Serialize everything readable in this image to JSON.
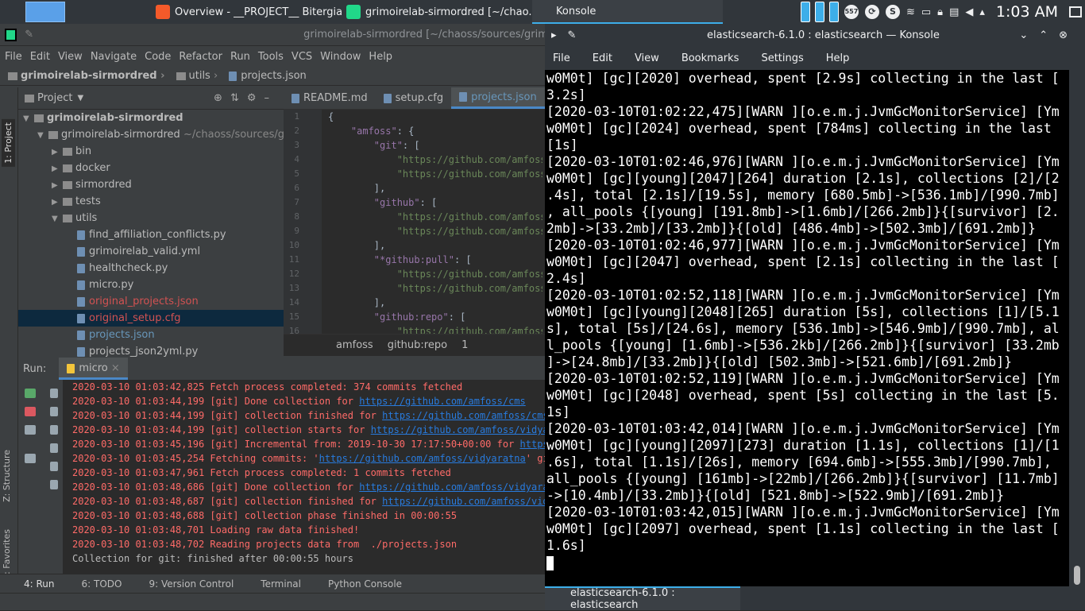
{
  "taskbar": {
    "tasks": [
      {
        "label": "Overview - __PROJECT__ Bitergia ...",
        "color": "#f45a2a"
      },
      {
        "label": "grimoirelab-sirmordred [~/chao...",
        "color": "#21d789"
      },
      {
        "label": "Konsole",
        "color": "#3b4045"
      }
    ],
    "clock": "1:03 AM",
    "tray_badge": "557"
  },
  "ide": {
    "title": "grimoirelab-sirmordred [~/chaoss/sources/grimoir",
    "menu": [
      "File",
      "Edit",
      "View",
      "Navigate",
      "Code",
      "Refactor",
      "Run",
      "Tools",
      "VCS",
      "Window",
      "Help"
    ],
    "breadcrumb": [
      "grimoirelab-sirmordred",
      "utils",
      "projects.json"
    ],
    "sidebar_tabs": [
      "1: Project",
      "Z: Structure",
      "2: Favorites"
    ],
    "project_panel": {
      "title": "Project",
      "tree": [
        {
          "label": "grimoirelab-sirmordred",
          "indent": 0,
          "arrow": "▼",
          "kind": "folder",
          "bold": true,
          "style": ""
        },
        {
          "label": "grimoirelab-sirmordred",
          "extra": "~/chaoss/sources/grim",
          "indent": 1,
          "arrow": "▼",
          "kind": "folder",
          "style": ""
        },
        {
          "label": "bin",
          "indent": 2,
          "arrow": "▶",
          "kind": "folder",
          "style": ""
        },
        {
          "label": "docker",
          "indent": 2,
          "arrow": "▶",
          "kind": "folder",
          "style": ""
        },
        {
          "label": "sirmordred",
          "indent": 2,
          "arrow": "▶",
          "kind": "folder",
          "style": ""
        },
        {
          "label": "tests",
          "indent": 2,
          "arrow": "▶",
          "kind": "folder",
          "style": ""
        },
        {
          "label": "utils",
          "indent": 2,
          "arrow": "▼",
          "kind": "folder",
          "style": ""
        },
        {
          "label": "find_affiliation_conflicts.py",
          "indent": 3,
          "arrow": "",
          "kind": "file",
          "style": ""
        },
        {
          "label": "grimoirelab_valid.yml",
          "indent": 3,
          "arrow": "",
          "kind": "file",
          "style": ""
        },
        {
          "label": "healthcheck.py",
          "indent": 3,
          "arrow": "",
          "kind": "file",
          "style": ""
        },
        {
          "label": "micro.py",
          "indent": 3,
          "arrow": "",
          "kind": "file",
          "style": ""
        },
        {
          "label": "original_projects.json",
          "indent": 3,
          "arrow": "",
          "kind": "file",
          "style": "red"
        },
        {
          "label": "original_setup.cfg",
          "indent": 3,
          "arrow": "",
          "kind": "file",
          "style": "red sel"
        },
        {
          "label": "projects.json",
          "indent": 3,
          "arrow": "",
          "kind": "file",
          "style": "blue"
        },
        {
          "label": "projects_json2yml.py",
          "indent": 3,
          "arrow": "",
          "kind": "file",
          "style": ""
        }
      ]
    },
    "editor": {
      "tabs": [
        {
          "label": "README.md",
          "active": false
        },
        {
          "label": "setup.cfg",
          "active": false
        },
        {
          "label": "projects.json",
          "active": true
        }
      ],
      "line_numbers": [
        "1",
        "2",
        "3",
        "4",
        "5",
        "6",
        "7",
        "8",
        "9",
        "10",
        "11",
        "12",
        "13",
        "14",
        "15",
        "16"
      ],
      "lines": [
        [
          {
            "c": "p",
            "t": "{"
          }
        ],
        [
          {
            "c": "k",
            "t": "    \"amfoss\""
          },
          {
            "c": "p",
            "t": ": {"
          }
        ],
        [
          {
            "c": "k",
            "t": "        \"git\""
          },
          {
            "c": "p",
            "t": ": ["
          }
        ],
        [
          {
            "c": "s",
            "t": "            \"https://github.com/amfoss"
          }
        ],
        [
          {
            "c": "s",
            "t": "            \"https://github.com/amfoss"
          }
        ],
        [
          {
            "c": "p",
            "t": "        ],"
          }
        ],
        [
          {
            "c": "k",
            "t": "        \"github\""
          },
          {
            "c": "p",
            "t": ": ["
          }
        ],
        [
          {
            "c": "s",
            "t": "            \"https://github.com/amfoss"
          }
        ],
        [
          {
            "c": "s",
            "t": "            \"https://github.com/amfoss"
          }
        ],
        [
          {
            "c": "p",
            "t": "        ],"
          }
        ],
        [
          {
            "c": "k",
            "t": "        \"*github:pull\""
          },
          {
            "c": "p",
            "t": ": ["
          }
        ],
        [
          {
            "c": "s",
            "t": "            \"https://github.com/amfoss"
          }
        ],
        [
          {
            "c": "s",
            "t": "            \"https://github.com/amfoss"
          }
        ],
        [
          {
            "c": "p",
            "t": "        ],"
          }
        ],
        [
          {
            "c": "k",
            "t": "        \"github:repo\""
          },
          {
            "c": "p",
            "t": ": ["
          }
        ],
        [
          {
            "c": "s",
            "t": "            \"https://github.com/amfoss"
          }
        ]
      ],
      "breadcrumb": [
        "amfoss",
        "github:repo",
        "1"
      ]
    },
    "run_panel": {
      "label": "Run:",
      "tab": "micro",
      "lines": [
        {
          "cls": "err",
          "text": "2020-03-10 01:03:42,825 Fetch process completed: 374 commits fetched",
          "link": ""
        },
        {
          "cls": "err",
          "text": "2020-03-10 01:03:44,199 [git] Done collection for ",
          "link": "https://github.com/amfoss/cms"
        },
        {
          "cls": "err",
          "text": "2020-03-10 01:03:44,199 [git] collection finished for ",
          "link": "https://github.com/amfoss/cms"
        },
        {
          "cls": "err",
          "text": "2020-03-10 01:03:44,199 [git] collection starts for ",
          "link": "https://github.com/amfoss/vidyara"
        },
        {
          "cls": "err",
          "text": "2020-03-10 01:03:45,196 [git] Incremental from: 2019-10-30 17:17:50+00:00 for ",
          "link": "https://"
        },
        {
          "cls": "err",
          "text": "2020-03-10 01:03:45,254 Fetching commits: '",
          "link": "https://github.com/amfoss/vidyaratna",
          "after": "' git"
        },
        {
          "cls": "err",
          "text": "2020-03-10 01:03:47,961 Fetch process completed: 1 commits fetched",
          "link": ""
        },
        {
          "cls": "err",
          "text": "2020-03-10 01:03:48,686 [git] Done collection for ",
          "link": "https://github.com/amfoss/vidyaratn"
        },
        {
          "cls": "err",
          "text": "2020-03-10 01:03:48,687 [git] collection finished for ",
          "link": "https://github.com/amfoss/vidya"
        },
        {
          "cls": "err",
          "text": "2020-03-10 01:03:48,688 [git] collection phase finished in 00:00:55",
          "link": ""
        },
        {
          "cls": "err",
          "text": "2020-03-10 01:03:48,701 Loading raw data finished!",
          "link": ""
        },
        {
          "cls": "err",
          "text": "2020-03-10 01:03:48,702 Reading projects data from  ./projects.json",
          "link": ""
        },
        {
          "cls": "ok",
          "text": "Collection for git: finished after 00:00:55 hours",
          "link": ""
        }
      ]
    },
    "bottom_tabs": [
      "4: Run",
      "6: TODO",
      "9: Version Control",
      "Terminal",
      "Python Console"
    ]
  },
  "konsole": {
    "title": "elasticsearch-6.1.0 : elasticsearch — Konsole",
    "menu": [
      "File",
      "Edit",
      "View",
      "Bookmarks",
      "Settings",
      "Help"
    ],
    "lines": [
      "w0M0t] [gc][2020] overhead, spent [2.9s] collecting in the last [",
      "3.2s]",
      "[2020-03-10T01:02:22,475][WARN ][o.e.m.j.JvmGcMonitorService] [Ym",
      "w0M0t] [gc][2024] overhead, spent [784ms] collecting in the last",
      "[1s]",
      "[2020-03-10T01:02:46,976][WARN ][o.e.m.j.JvmGcMonitorService] [Ym",
      "w0M0t] [gc][young][2047][264] duration [2.1s], collections [2]/[2",
      ".4s], total [2.1s]/[19.5s], memory [680.5mb]->[536.1mb]/[990.7mb]",
      ", all_pools {[young] [191.8mb]->[1.6mb]/[266.2mb]}{[survivor] [2.",
      "2mb]->[33.2mb]/[33.2mb]}{[old] [486.4mb]->[502.3mb]/[691.2mb]}",
      "[2020-03-10T01:02:46,977][WARN ][o.e.m.j.JvmGcMonitorService] [Ym",
      "w0M0t] [gc][2047] overhead, spent [2.1s] collecting in the last [",
      "2.4s]",
      "[2020-03-10T01:02:52,118][WARN ][o.e.m.j.JvmGcMonitorService] [Ym",
      "w0M0t] [gc][young][2048][265] duration [5s], collections [1]/[5.1",
      "s], total [5s]/[24.6s], memory [536.1mb]->[546.9mb]/[990.7mb], al",
      "l_pools {[young] [1.6mb]->[536.2kb]/[266.2mb]}{[survivor] [33.2mb",
      "]->[24.8mb]/[33.2mb]}{[old] [502.3mb]->[521.6mb]/[691.2mb]}",
      "[2020-03-10T01:02:52,119][WARN ][o.e.m.j.JvmGcMonitorService] [Ym",
      "w0M0t] [gc][2048] overhead, spent [5s] collecting in the last [5.",
      "1s]",
      "[2020-03-10T01:03:42,014][WARN ][o.e.m.j.JvmGcMonitorService] [Ym",
      "w0M0t] [gc][young][2097][273] duration [1.1s], collections [1]/[1",
      ".6s], total [1.1s]/[26s], memory [694.6mb]->[555.3mb]/[990.7mb],",
      "all_pools {[young] [161mb]->[22mb]/[266.2mb]}{[survivor] [11.7mb]",
      "->[10.4mb]/[33.2mb]}{[old] [521.8mb]->[522.9mb]/[691.2mb]}",
      "[2020-03-10T01:03:42,015][WARN ][o.e.m.j.JvmGcMonitorService] [Ym",
      "w0M0t] [gc][2097] overhead, spent [1.1s] collecting in the last [",
      "1.6s]"
    ],
    "tab_label": "elasticsearch-6.1.0 : elasticsearch"
  }
}
